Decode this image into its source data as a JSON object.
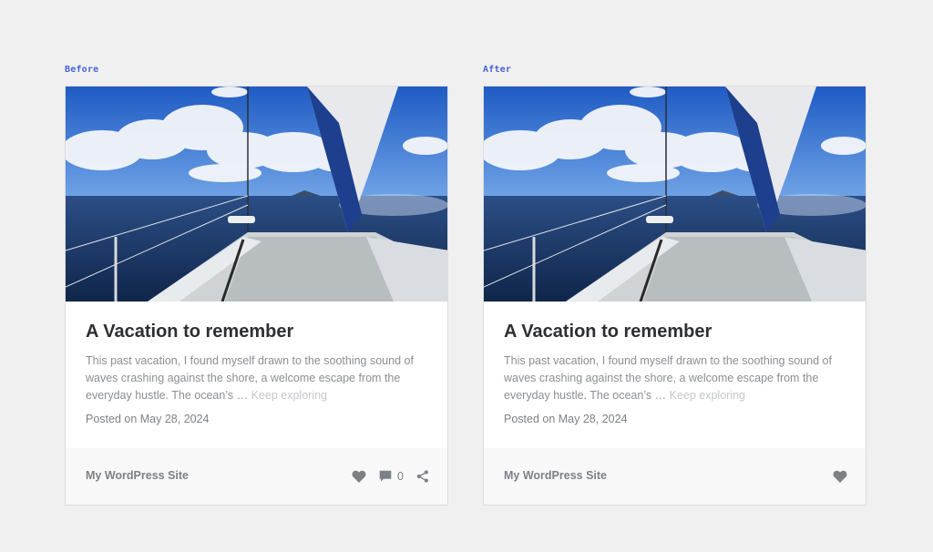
{
  "panels": [
    {
      "label": "Before",
      "card": {
        "title": "A Vacation to remember",
        "excerpt": "This past vacation, I found myself drawn to the soothing sound of waves crashing against the shore, a welcome escape from the everyday hustle. The ocean’s … ",
        "read_more": "Keep exploring",
        "date": "Posted on May 28, 2024",
        "site": "My WordPress Site",
        "comment_count": "0",
        "actions": [
          "heart-icon",
          "comment-icon",
          "share-icon"
        ]
      }
    },
    {
      "label": "After",
      "card": {
        "title": "A Vacation to remember",
        "excerpt": "This past vacation, I found myself drawn to the soothing sound of waves crashing against the shore, a welcome escape from the everyday hustle. The ocean’s … ",
        "read_more": "Keep exploring",
        "date": "Posted on May 28, 2024",
        "site": "My WordPress Site",
        "actions": [
          "heart-icon"
        ]
      }
    }
  ],
  "colors": {
    "background": "#f0f0f0",
    "label_accent": "#4a63d6",
    "title": "#2d2f33",
    "muted_text": "#8b8e93",
    "icon": "#7d8085"
  }
}
